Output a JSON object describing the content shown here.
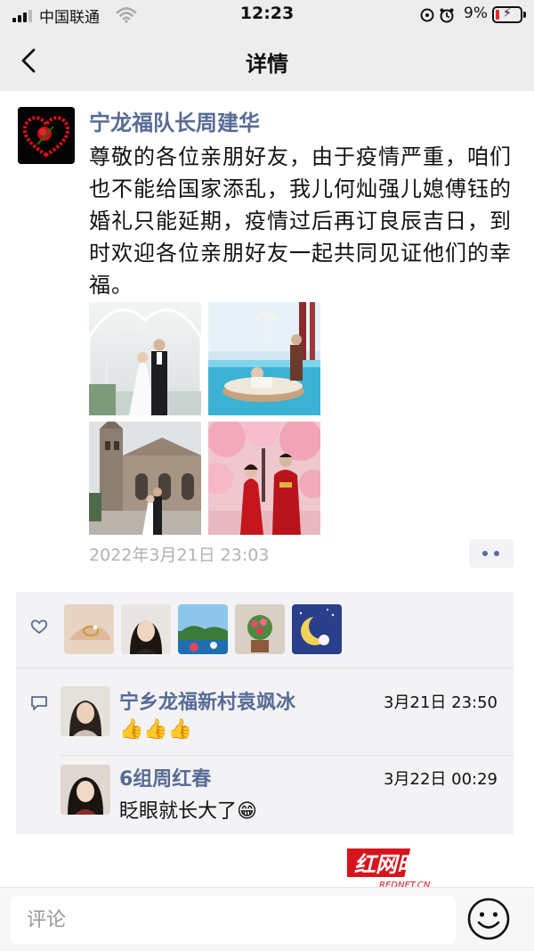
{
  "status_bar": {
    "carrier": "中国联通",
    "time": "12:23",
    "battery": "9%"
  },
  "nav": {
    "title": "详情"
  },
  "post": {
    "author": "宁龙福队长周建华",
    "text": "尊敬的各位亲朋好友，由于疫情严重，咱们也不能给国家添乱，我儿何灿强儿媳傅钰的婚礼只能延期，疫情过后再订良辰吉日，到时欢迎各位亲朋好友一起共同见证他们的幸福。",
    "timestamp": "2022年3月21日 23:03"
  },
  "comments": [
    {
      "name": "宁乡龙福新村袁飒冰",
      "time": "3月21日 23:50",
      "text": "👍👍👍"
    },
    {
      "name": "6组周红春",
      "time": "3月22日 00:29",
      "text": "眨眼就长大了😁"
    }
  ],
  "watermark": {
    "text": "红网时刻",
    "sub": "REDNET.CN"
  },
  "comment_bar": {
    "placeholder": "评论"
  },
  "colors": {
    "link": "#576b95",
    "nav_bg": "#ededed",
    "box_bg": "#f3f3f5"
  }
}
